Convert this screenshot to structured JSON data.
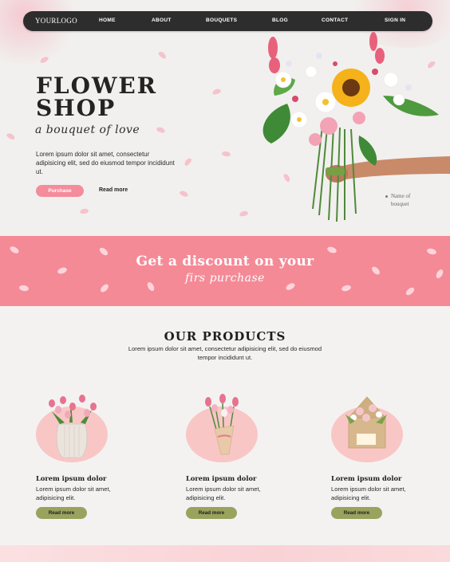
{
  "nav": {
    "logo": "YOURLOGO",
    "items": [
      "HOME",
      "ABOUT",
      "BOUQUETS",
      "BLOG",
      "CONTACT",
      "SIGN IN"
    ]
  },
  "hero": {
    "title_line1": "FLOWER",
    "title_line2": "SHOP",
    "script": "a bouquet of love",
    "text": "Lorem ipsum dolor sit amet, consectetur adipisicing elit, sed do eiusmod tempor incididunt ut.",
    "purchase_label": "Purchase",
    "read_more_label": "Read more",
    "caption_line1": "Name of",
    "caption_line2": "bouquet"
  },
  "banner": {
    "line1": "Get a discount on your",
    "line2": "firs purchase"
  },
  "products": {
    "title": "OUR PRODUCTS",
    "subtitle": "Lorem ipsum dolor sit amet, consectetur adipisicing elit, sed do eiusmod tempor incididunt ut.",
    "items": [
      {
        "name": "Lorem ipsum dolor",
        "desc": "Lorem ipsum dolor sit amet, adipisicing elit.",
        "button": "Read more"
      },
      {
        "name": "Lorem ipsum dolor",
        "desc": "Lorem ipsum dolor sit amet, adipisicing elit.",
        "button": "Read more"
      },
      {
        "name": "Lorem ipsum dolor",
        "desc": "Lorem ipsum dolor sit amet, adipisicing elit.",
        "button": "Read more"
      }
    ]
  },
  "colors": {
    "pink": "#f58a97",
    "light_pink": "#f9c6c6",
    "olive": "#9aa25e",
    "nav_bg": "#2d2d2d"
  }
}
